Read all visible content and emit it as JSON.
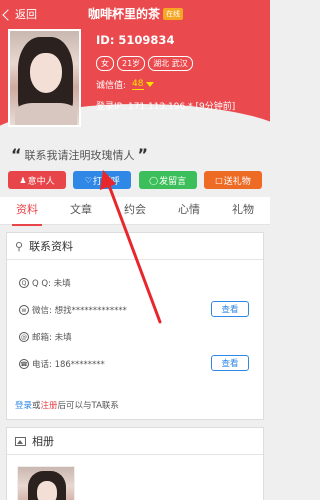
{
  "header": {
    "back_label": "返回",
    "title": "咖啡杯里的茶",
    "online_badge": "在线"
  },
  "profile": {
    "id_text": "ID: 5109834",
    "tags": [
      "女",
      "21岁",
      "湖北 武汉"
    ],
    "credit_label": "诚信值:",
    "credit_value": "48",
    "ip_text": "登录IP:   171.113.196.* [9分钟前]"
  },
  "slogan": {
    "open_quote": "“",
    "text": "联系我请注明玫瑰情人",
    "close_quote": "”"
  },
  "actions": [
    {
      "label": "意中人",
      "icon": "person-icon",
      "color": "#e8454a"
    },
    {
      "label": "打招呼",
      "icon": "heart-icon",
      "color": "#2f87e6"
    },
    {
      "label": "发留言",
      "icon": "chat-icon",
      "color": "#3cbf5a"
    },
    {
      "label": "送礼物",
      "icon": "gift-icon",
      "color": "#ee6b26"
    }
  ],
  "tabs": [
    {
      "label": "资料",
      "active": true
    },
    {
      "label": "文章",
      "active": false
    },
    {
      "label": "约会",
      "active": false
    },
    {
      "label": "心情",
      "active": false
    },
    {
      "label": "礼物",
      "active": false
    }
  ],
  "contact": {
    "title": "联系资料",
    "rows": [
      {
        "icon": "qq-icon",
        "text": "Q Q: 未填",
        "has_button": false
      },
      {
        "icon": "wechat-icon",
        "text": "微信: 想找*************",
        "has_button": true
      },
      {
        "icon": "email-icon",
        "text": "邮箱: 未填",
        "has_button": false
      },
      {
        "icon": "phone-icon",
        "text": "电话: 186********",
        "has_button": true
      }
    ],
    "view_label": "查看",
    "footer_login": "登录",
    "footer_or": "或",
    "footer_register": "注册",
    "footer_tail": "后可以与TA联系"
  },
  "album": {
    "title": "相册"
  },
  "colors": {
    "brand_red": "#ea4a4e",
    "link_blue": "#2f87e6",
    "annotation_red": "#e8272c"
  }
}
